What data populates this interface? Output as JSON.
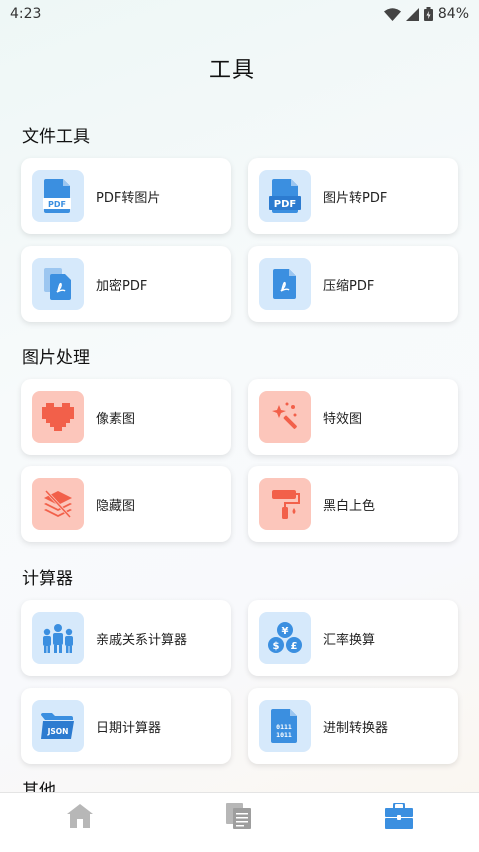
{
  "status": {
    "time": "4:23",
    "battery": "84%"
  },
  "page_title": "工具",
  "sections": [
    {
      "title": "文件工具",
      "items": [
        {
          "label": "PDF转图片",
          "icon": "pdf-file-icon"
        },
        {
          "label": "图片转PDF",
          "icon": "pdf-badge-icon"
        },
        {
          "label": "加密PDF",
          "icon": "pdf-lock-icon"
        },
        {
          "label": "压缩PDF",
          "icon": "pdf-compress-icon"
        }
      ]
    },
    {
      "title": "图片处理",
      "items": [
        {
          "label": "像素图",
          "icon": "pixel-heart-icon"
        },
        {
          "label": "特效图",
          "icon": "magic-wand-icon"
        },
        {
          "label": "隐藏图",
          "icon": "hidden-layers-icon"
        },
        {
          "label": "黑白上色",
          "icon": "paint-roller-icon"
        }
      ]
    },
    {
      "title": "计算器",
      "items": [
        {
          "label": "亲戚关系计算器",
          "icon": "family-icon"
        },
        {
          "label": "汇率换算",
          "icon": "currency-icon"
        },
        {
          "label": "日期计算器",
          "icon": "json-folder-icon"
        },
        {
          "label": "进制转换器",
          "icon": "binary-file-icon"
        }
      ],
      "item_texts": {
        "json": "JSON",
        "bin_top": "0111",
        "bin_bottom": "1011"
      }
    }
  ],
  "partial_section_title": "其他",
  "nav": [
    {
      "name": "home",
      "icon": "home-icon"
    },
    {
      "name": "documents",
      "icon": "documents-icon"
    },
    {
      "name": "tools",
      "icon": "toolbox-icon",
      "active": true
    }
  ],
  "colors": {
    "blue": "#3b8fe0",
    "coral": "#f2604a",
    "nav_inactive": "#b7b7b7"
  }
}
